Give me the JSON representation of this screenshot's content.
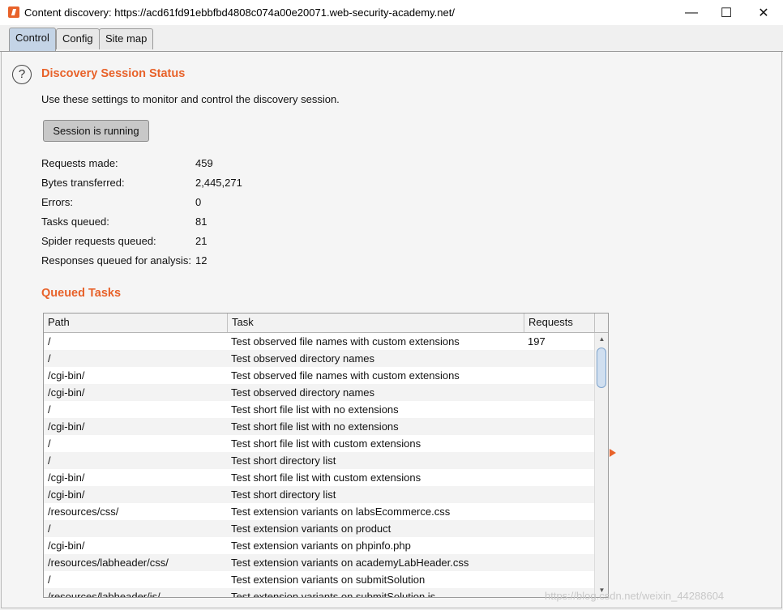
{
  "window": {
    "title": "Content discovery: https://acd61fd91ebbfbd4808c074a00e20071.web-security-academy.net/",
    "minimize": "—",
    "maximize": "☐",
    "close": "✕"
  },
  "tabs": [
    {
      "label": "Control"
    },
    {
      "label": "Config"
    },
    {
      "label": "Site map"
    }
  ],
  "status": {
    "help_glyph": "?",
    "heading": "Discovery Session Status",
    "description": "Use these settings to monitor and control the discovery session.",
    "session_button": "Session is running",
    "stats": [
      {
        "label": "Requests made:",
        "value": "459"
      },
      {
        "label": "Bytes transferred:",
        "value": "2,445,271"
      },
      {
        "label": "Errors:",
        "value": "0"
      },
      {
        "label": "Tasks queued:",
        "value": "81"
      },
      {
        "label": "Spider requests queued:",
        "value": "21"
      },
      {
        "label": "Responses queued for analysis:",
        "value": "12"
      }
    ]
  },
  "queued": {
    "heading": "Queued Tasks",
    "columns": [
      "Path",
      "Task",
      "Requests"
    ],
    "rows": [
      {
        "path": "/",
        "task": "Test observed file names with custom extensions",
        "requests": "197"
      },
      {
        "path": "/",
        "task": "Test observed directory names",
        "requests": ""
      },
      {
        "path": "/cgi-bin/",
        "task": "Test observed file names with custom extensions",
        "requests": ""
      },
      {
        "path": "/cgi-bin/",
        "task": "Test observed directory names",
        "requests": ""
      },
      {
        "path": "/",
        "task": "Test short file list with no extensions",
        "requests": ""
      },
      {
        "path": "/cgi-bin/",
        "task": "Test short file list with no extensions",
        "requests": ""
      },
      {
        "path": "/",
        "task": "Test short file list with custom extensions",
        "requests": ""
      },
      {
        "path": "/",
        "task": "Test short directory list",
        "requests": ""
      },
      {
        "path": "/cgi-bin/",
        "task": "Test short file list with custom extensions",
        "requests": ""
      },
      {
        "path": "/cgi-bin/",
        "task": "Test short directory list",
        "requests": ""
      },
      {
        "path": "/resources/css/",
        "task": "Test extension variants on labsEcommerce.css",
        "requests": ""
      },
      {
        "path": "/",
        "task": "Test extension variants on product",
        "requests": ""
      },
      {
        "path": "/cgi-bin/",
        "task": "Test extension variants on phpinfo.php",
        "requests": ""
      },
      {
        "path": "/resources/labheader/css/",
        "task": "Test extension variants on academyLabHeader.css",
        "requests": ""
      },
      {
        "path": "/",
        "task": "Test extension variants on submitSolution",
        "requests": ""
      },
      {
        "path": "/resources/labheader/js/",
        "task": "Test extension variants on submitSolution.js",
        "requests": ""
      }
    ]
  },
  "watermark": "https://blog.csdn.net/weixin_44288604",
  "colors": {
    "accent": "#e8622a",
    "tab_active": "#c4d4e6"
  }
}
